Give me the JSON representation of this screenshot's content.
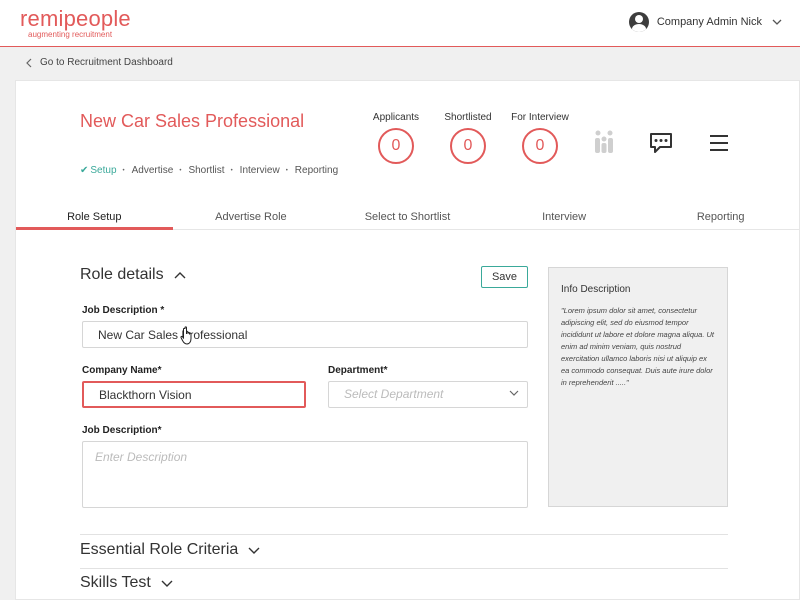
{
  "brand": {
    "name": "remipeople",
    "tagline": "augmenting recruitment",
    "color": "#e25a5a"
  },
  "user": {
    "name": "Company Admin Nick"
  },
  "nav": {
    "back_label": "Go to Recruitment Dashboard"
  },
  "job": {
    "title": "New Car Sales Professional",
    "breadcrumb": [
      "Setup",
      "Advertise",
      "Shortlist",
      "Interview",
      "Reporting"
    ]
  },
  "stats": [
    {
      "label": "Applicants",
      "value": "0"
    },
    {
      "label": "Shortlisted",
      "value": "0"
    },
    {
      "label": "For Interview",
      "value": "0"
    }
  ],
  "tabs": [
    "Role Setup",
    "Advertise Role",
    "Select to Shortlist",
    "Interview",
    "Reporting"
  ],
  "role_details": {
    "title": "Role details",
    "save_label": "Save",
    "job_description_label": "Job Description *",
    "job_description_value": "New Car Sales Professional",
    "company_label": "Company Name*",
    "company_value": "Blackthorn Vision",
    "department_label": "Department*",
    "department_placeholder": "Select Department",
    "description_label": "Job Description*",
    "description_placeholder": "Enter Description"
  },
  "info": {
    "title": "Info Description",
    "text": "\"Lorem ipsum dolor sit amet, consectetur adipiscing elit, sed do eiusmod tempor incididunt ut labore et dolore magna aliqua. Ut enim ad minim veniam, quis nostrud exercitation ullamco laboris nisi ut aliquip ex ea commodo consequat. Duis aute irure dolor in reprehenderit .....\""
  },
  "sections": {
    "essential": "Essential Role Criteria",
    "skills": "Skills Test"
  },
  "colors": {
    "accent": "#e25a5a",
    "teal": "#3aa99a"
  }
}
